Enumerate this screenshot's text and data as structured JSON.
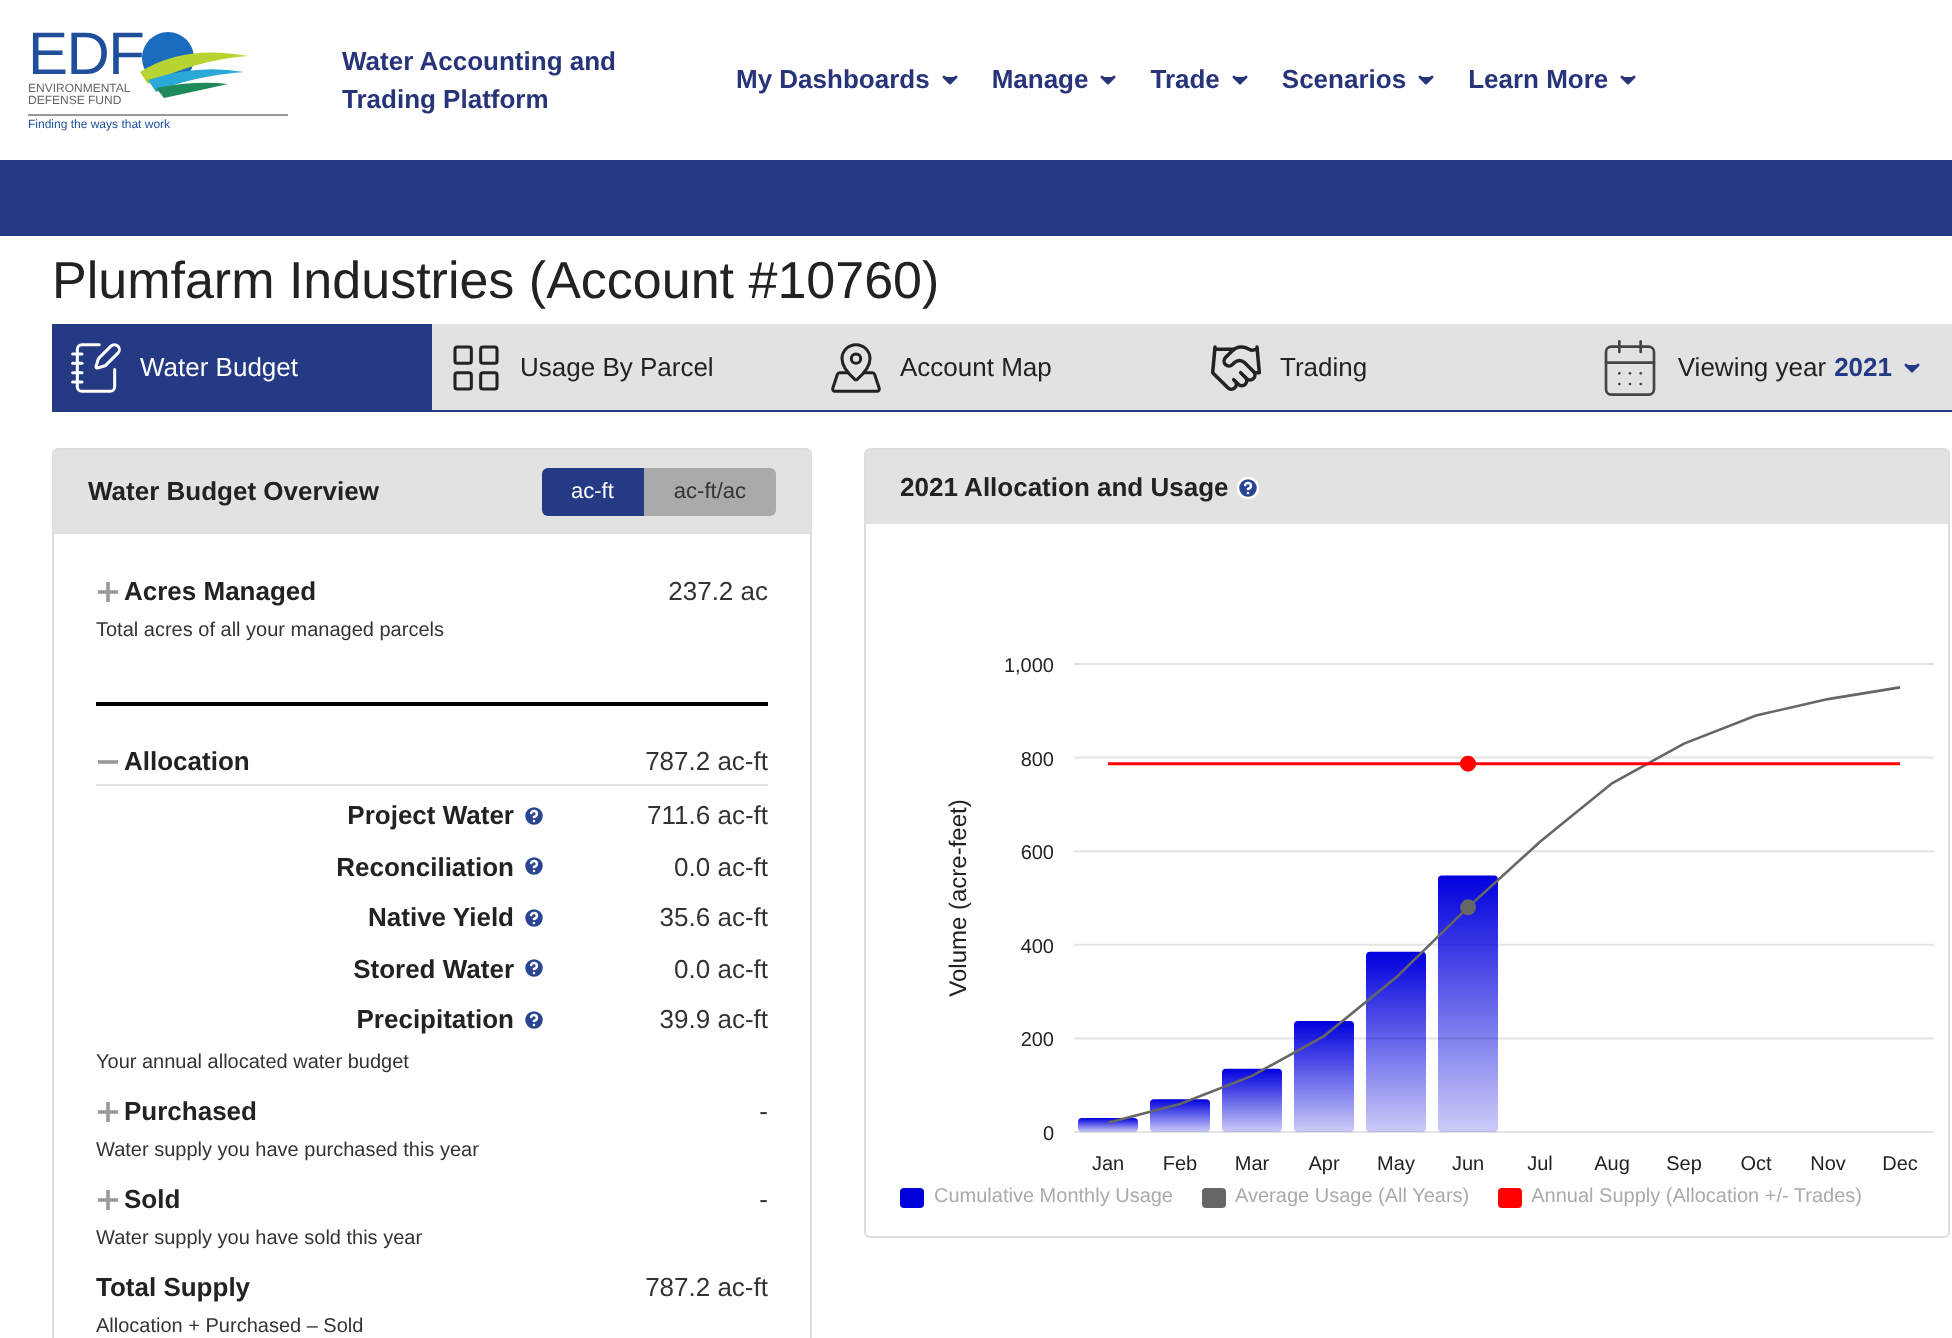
{
  "logo": {
    "mark": "EDF",
    "name_line_1": "ENVIRONMENTAL",
    "name_line_2": "DEFENSE FUND",
    "tagline": "Finding the ways that work"
  },
  "app_title": "Water Accounting and Trading Platform",
  "nav": [
    {
      "label": "My Dashboards"
    },
    {
      "label": "Manage"
    },
    {
      "label": "Trade"
    },
    {
      "label": "Scenarios"
    },
    {
      "label": "Learn More"
    }
  ],
  "page_title": "Plumfarm Industries (Account #10760)",
  "tabs": [
    {
      "label": "Water Budget",
      "kind": "budget",
      "selected": true
    },
    {
      "label": "Usage By Parcel",
      "kind": "parcel",
      "selected": false
    },
    {
      "label": "Account Map",
      "kind": "map",
      "selected": false
    },
    {
      "label": "Trading",
      "kind": "trading",
      "selected": false
    }
  ],
  "year_picker": {
    "label": "Viewing year",
    "year": "2021"
  },
  "overview": {
    "title": "Water Budget Overview",
    "units": [
      {
        "label": "ac-ft",
        "selected": true
      },
      {
        "label": "ac-ft/ac",
        "selected": false
      }
    ],
    "sections": [
      {
        "kind": "section",
        "label": "Acres Managed",
        "value": "237.2 ac",
        "expanded": false,
        "note": "Total acres of all your managed parcels"
      },
      {
        "kind": "rule"
      },
      {
        "kind": "section",
        "label": "Allocation",
        "value": "787.2 ac-ft",
        "expanded": true,
        "items": [
          {
            "label": "Project Water",
            "value": "711.6 ac-ft"
          },
          {
            "label": "Reconciliation",
            "value": "0.0 ac-ft"
          },
          {
            "label": "Native Yield",
            "value": "35.6 ac-ft"
          },
          {
            "label": "Stored Water",
            "value": "0.0 ac-ft"
          },
          {
            "label": "Precipitation",
            "value": "39.9 ac-ft"
          }
        ],
        "note": "Your annual allocated water budget"
      },
      {
        "kind": "section",
        "label": "Purchased",
        "value": "-",
        "expanded": false,
        "note": "Water supply you have purchased this year"
      },
      {
        "kind": "section",
        "label": "Sold",
        "value": "-",
        "expanded": false,
        "note": "Water supply you have sold this year"
      },
      {
        "kind": "total",
        "label": "Total Supply",
        "value": "787.2 ac-ft",
        "note": "Allocation + Purchased – Sold"
      }
    ]
  },
  "usage_panel": {
    "title": "2021 Allocation and Usage",
    "chart_data": {
      "type": "bar",
      "grid": true,
      "ylabel": "Volume (acre-feet)",
      "categories": [
        "Jan",
        "Feb",
        "Mar",
        "Apr",
        "May",
        "Jun",
        "Jul",
        "Aug",
        "Sep",
        "Oct",
        "Nov",
        "Dec"
      ],
      "ylim": [
        0,
        1000
      ],
      "yticks": [
        0,
        {
          "value": 200,
          "label": "200"
        },
        {
          "value": 400,
          "label": "400"
        },
        {
          "value": 600,
          "label": "600"
        },
        {
          "value": 800,
          "label": "800"
        },
        {
          "value": 1000,
          "label": "1,000"
        }
      ],
      "series": [
        {
          "name": "Cumulative Monthly Usage",
          "color": "#0000dd",
          "values": [
            30,
            70,
            135,
            237,
            385,
            548,
            null,
            null,
            null,
            null,
            null,
            null
          ]
        },
        {
          "name": "Average Usage (All Years)",
          "color": "#666666",
          "type": "line",
          "values": [
            20,
            60,
            120,
            205,
            330,
            480,
            620,
            745,
            830,
            890,
            925,
            950
          ]
        },
        {
          "name": "Annual Supply (Allocation +/- Trades)",
          "color": "#ff0000",
          "type": "line",
          "values": [
            787,
            787,
            787,
            787,
            787,
            787,
            787,
            787,
            787,
            787,
            787,
            787
          ]
        }
      ]
    }
  }
}
